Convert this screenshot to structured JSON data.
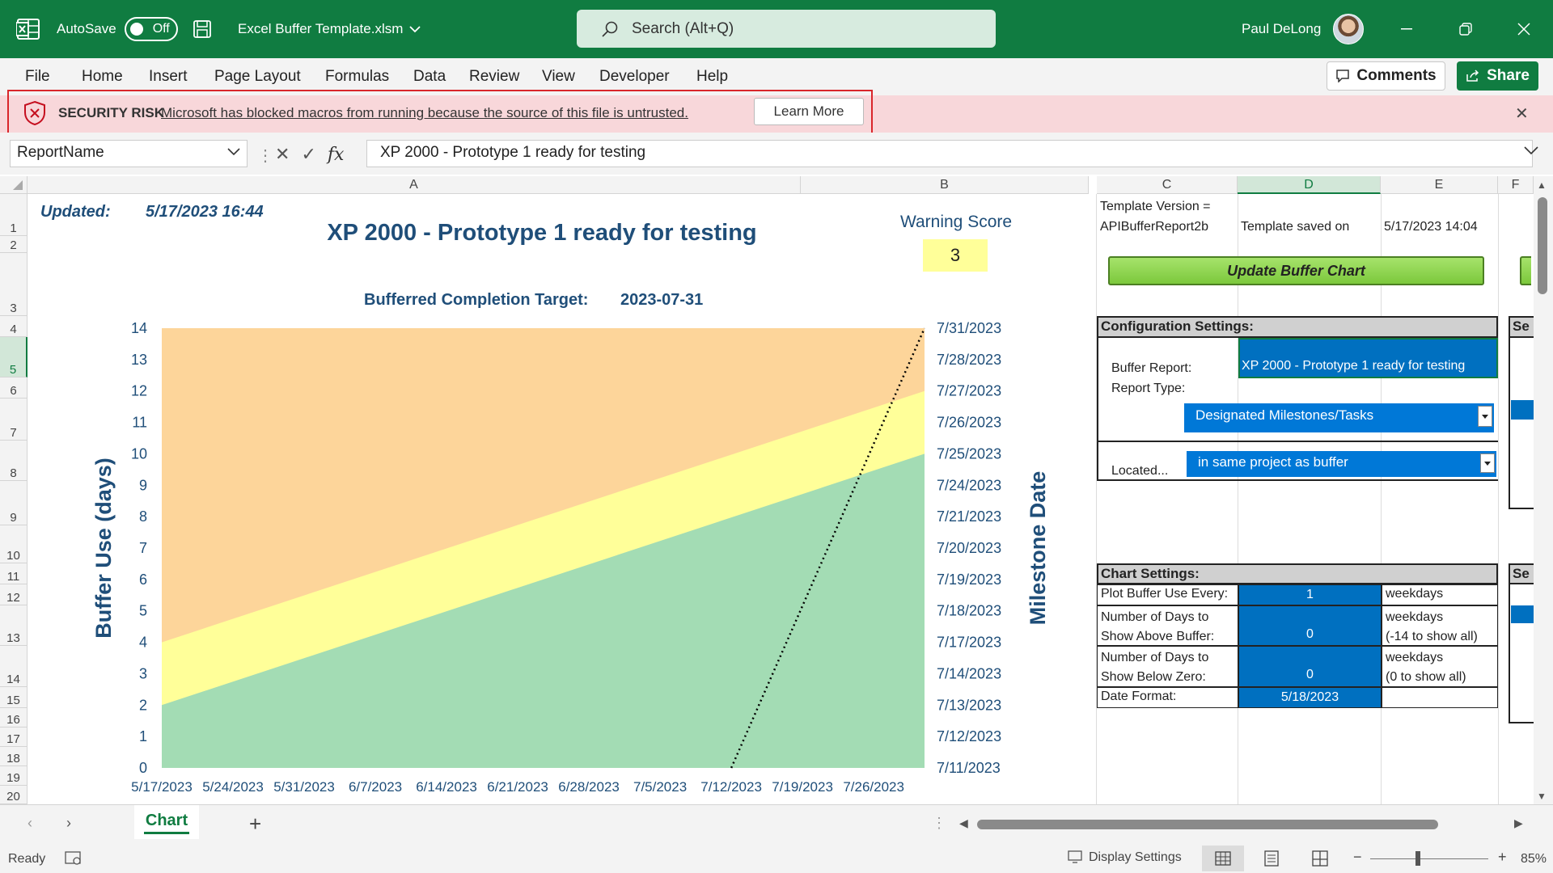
{
  "titlebar": {
    "autosave_label": "AutoSave",
    "autosave_state": "Off",
    "filename": "Excel Buffer Template.xlsm",
    "search_placeholder": "Search (Alt+Q)",
    "user_name": "Paul DeLong"
  },
  "menu": [
    "File",
    "Home",
    "Insert",
    "Page Layout",
    "Formulas",
    "Data",
    "Review",
    "View",
    "Developer",
    "Help"
  ],
  "ribbon_buttons": {
    "comments": "Comments",
    "share": "Share"
  },
  "security_bar": {
    "label": "SECURITY RISK",
    "message": "Microsoft has blocked macros from running because the source of this file is untrusted.",
    "button": "Learn More"
  },
  "formula_bar": {
    "name_box": "ReportName",
    "formula": "XP 2000 - Prototype 1 ready for testing"
  },
  "columns": [
    "A",
    "B",
    "C",
    "D",
    "E",
    "F"
  ],
  "rows": [
    "1",
    "2",
    "3",
    "4",
    "5",
    "6",
    "7",
    "8",
    "9",
    "10",
    "11",
    "12",
    "13",
    "14",
    "15",
    "16",
    "17",
    "18",
    "19",
    "20"
  ],
  "sheet": {
    "updated_label": "Updated:",
    "updated_value": "5/17/2023 16:44",
    "report_title": "XP 2000 - Prototype 1 ready for testing",
    "warning_score_label": "Warning Score",
    "warning_score_value": "3",
    "target_label": "Bufferred Completion Target:",
    "target_value": "2023-07-31"
  },
  "chart_data": {
    "type": "area",
    "ylabel": "Buffer Use (days)",
    "y2label": "Milestone Date",
    "ylim": [
      0,
      14
    ],
    "yticks": [
      "0",
      "1",
      "2",
      "3",
      "4",
      "5",
      "6",
      "7",
      "8",
      "9",
      "10",
      "11",
      "12",
      "13",
      "14"
    ],
    "y2ticks": [
      "7/11/2023",
      "7/12/2023",
      "7/13/2023",
      "7/14/2023",
      "7/17/2023",
      "7/18/2023",
      "7/19/2023",
      "7/20/2023",
      "7/21/2023",
      "7/24/2023",
      "7/25/2023",
      "7/26/2023",
      "7/27/2023",
      "7/28/2023",
      "7/31/2023"
    ],
    "xticks": [
      "5/17/2023",
      "5/24/2023",
      "5/31/2023",
      "6/7/2023",
      "6/14/2023",
      "6/21/2023",
      "6/28/2023",
      "7/5/2023",
      "7/12/2023",
      "7/19/2023",
      "7/26/2023"
    ],
    "x_range": [
      "5/17/2023",
      "7/31/2023"
    ],
    "series": [
      {
        "zone": "green",
        "start": 2,
        "end": 10,
        "color": "#a3dcb4"
      },
      {
        "zone": "yellow",
        "start": 4,
        "end": 12,
        "color": "#ffff99"
      },
      {
        "zone": "orange",
        "start": 14,
        "end": 14,
        "color": "#fdd59a"
      }
    ],
    "milestone_line": {
      "x_start": "7/12/2023",
      "y_start": 0,
      "x_end": "7/31/2023",
      "y_end": 14,
      "style": "dotted",
      "color": "#000000"
    }
  },
  "right_panel": {
    "template_version_label": "Template Version =",
    "template_version_value": "APIBufferReport2b",
    "template_saved_label": "Template saved on",
    "template_saved_value": "5/17/2023 14:04",
    "update_button": "Update Buffer Chart",
    "config_header": "Configuration Settings:",
    "buffer_report_label": "Buffer Report:",
    "buffer_report_value": "XP 2000 - Prototype 1 ready for testing",
    "report_type_label": "Report Type:",
    "report_type_value": "Designated Milestones/Tasks",
    "located_label": "Located...",
    "located_value": "in same project as buffer",
    "chart_header": "Chart Settings:",
    "plot_every_label": "Plot Buffer Use Every:",
    "plot_every_value": "1",
    "plot_every_unit": "weekdays",
    "days_above_label_1": "Number of Days to",
    "days_above_label_2": "Show Above Buffer:",
    "days_above_value": "0",
    "days_above_unit_1": "weekdays",
    "days_above_unit_2": "(-14 to show all)",
    "days_below_label_1": "Number of Days to",
    "days_below_label_2": "Show Below Zero:",
    "days_below_value": "0",
    "days_below_unit_1": "weekdays",
    "days_below_unit_2": "(0 to show all)",
    "date_format_label": "Date Format:",
    "date_format_value": "5/18/2023",
    "side_header_1": "Se",
    "side_header_2": "Se"
  },
  "bottom": {
    "sheet_tab": "Chart",
    "status": "Ready",
    "display_settings": "Display Settings",
    "zoom": "85%"
  }
}
